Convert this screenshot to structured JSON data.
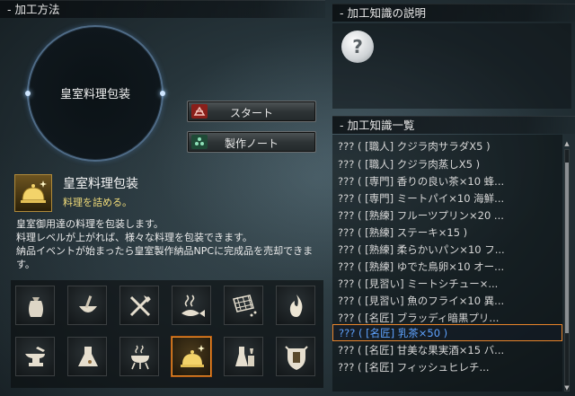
{
  "header_method": "- 加工方法",
  "header_description": "- 加工知識の説明",
  "header_list": "- 加工知識一覧",
  "ring_label": "皇室料理包装",
  "buttons": {
    "start": "スタート",
    "note": "製作ノート"
  },
  "recipe": {
    "title": "皇室料理包装",
    "subtitle": "料理を詰める。",
    "description": [
      "皇室御用達の料理を包装します。",
      "料理レベルが上がれば、様々な料理を包装できます。",
      "納品イベントが始まったら皇室製作納品NPCに完成品を売却できま",
      "す。"
    ]
  },
  "description_icon": "?",
  "categories": [
    {
      "name": "bag",
      "icon": "sack-icon"
    },
    {
      "name": "bowl",
      "icon": "mortar-icon"
    },
    {
      "name": "tools",
      "icon": "axe-hammer-icon"
    },
    {
      "name": "fish",
      "icon": "steaming-fish-icon"
    },
    {
      "name": "net",
      "icon": "net-icon"
    },
    {
      "name": "fire",
      "icon": "fire-icon"
    },
    {
      "name": "anvil",
      "icon": "anvil-icon"
    },
    {
      "name": "alchemy",
      "icon": "flask-icon"
    },
    {
      "name": "grill",
      "icon": "grill-icon"
    },
    {
      "name": "cloche",
      "icon": "cloche-icon",
      "selected": true
    },
    {
      "name": "potion",
      "icon": "potion-icon"
    },
    {
      "name": "shield",
      "icon": "crest-icon"
    }
  ],
  "list_items": [
    "??? ( [職人] クジラ肉サラダX5 )",
    "??? ( [職人] クジラ肉蒸しX5 )",
    "??? ( [専門] 香りの良い茶×10 蜂...",
    "??? ( [専門] ミートパイ×10 海鮮...",
    "??? ( [熟練] フルーツプリン×20 ...",
    "??? ( [熟練] ステーキ×15 )",
    "??? ( [熟練] 柔らかいパン×10 フ...",
    "??? ( [熟練] ゆでた鳥卵×10 オー...",
    "??? ( [見習い] ミートシチュー×...",
    "??? ( [見習い] 魚のフライ×10 異...",
    "??? ( [名匠] ブラッディ暗黒プリ...",
    "??? ( [名匠] 乳茶×50 )",
    "??? ( [名匠] 甘美な果実酒×15 バ...",
    "??? ( [名匠] フィッシュヒレチ..."
  ],
  "selected_list_index": 11,
  "colors": {
    "accent_orange": "#e8842a",
    "subtitle_yellow": "#f1dc7a",
    "selected_text_blue": "#5fa3ff"
  }
}
